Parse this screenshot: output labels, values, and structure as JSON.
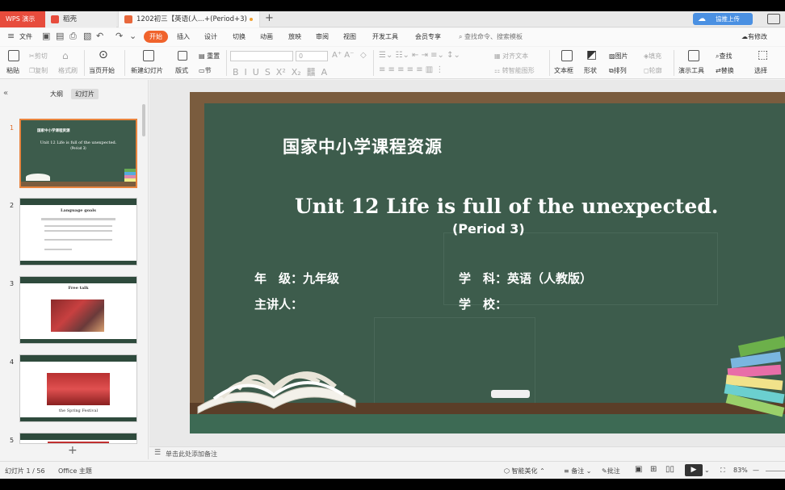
{
  "tabs": {
    "app": "WPS 演示",
    "daoke": "稻壳",
    "doc": "1202初三【英语(人...+(Period+3)",
    "upload": "協推上传"
  },
  "menu": {
    "file": "文件",
    "items": [
      "开始",
      "插入",
      "设计",
      "切换",
      "动画",
      "放映",
      "审阅",
      "视图",
      "开发工具",
      "会员专享"
    ],
    "search": "查找命令、搜索模板",
    "edit_mode": "有修改"
  },
  "ribbon": {
    "paste": "粘贴",
    "cut": "剪切",
    "copy": "复制",
    "format_painter": "格式刷",
    "from_current": "当页开始",
    "new_slide": "新建幻灯片",
    "layout": "版式",
    "section": "节",
    "reset": "重置",
    "font_size": "0",
    "align_text": "对齐文本",
    "convert_smartart": "转智能图形",
    "textbox": "文本框",
    "shape": "形状",
    "picture": "图片",
    "fill": "填充",
    "arrange": "排列",
    "outline": "轮廓",
    "presentation_tools": "演示工具",
    "find": "查找",
    "replace": "替换",
    "select": "选择"
  },
  "left_panel": {
    "tab_outline": "大纲",
    "tab_slides": "幻灯片",
    "thumbs": [
      {
        "num": "1",
        "title": "国家中小学课程资源",
        "sub": "Unit 12 Life is full of the unexpected.",
        "period": "(Period 3)"
      },
      {
        "num": "2",
        "title": "Language goals"
      },
      {
        "num": "3",
        "title": "Free talk"
      },
      {
        "num": "4",
        "title": "the Spring Festival"
      },
      {
        "num": "5",
        "title": ""
      }
    ]
  },
  "slide": {
    "title": "国家中小学课程资源",
    "unit": "Unit 12 Life is full of the unexpected.",
    "period": "(Period 3)",
    "grade": "年　级：九年级",
    "subject": "学　科：英语（人教版）",
    "lecturer": "主讲人：",
    "school": "学　校："
  },
  "notes": "单击此处添加备注",
  "status": {
    "slide_count": "幻灯片 1 / 56",
    "theme": "Office 主题",
    "beautify": "智能美化",
    "notes": "备注",
    "comments": "批注",
    "zoom": "83%"
  },
  "colors": {
    "accent": "#f0632c",
    "board": "#3d5c4c",
    "frame": "#7a5c3e"
  }
}
